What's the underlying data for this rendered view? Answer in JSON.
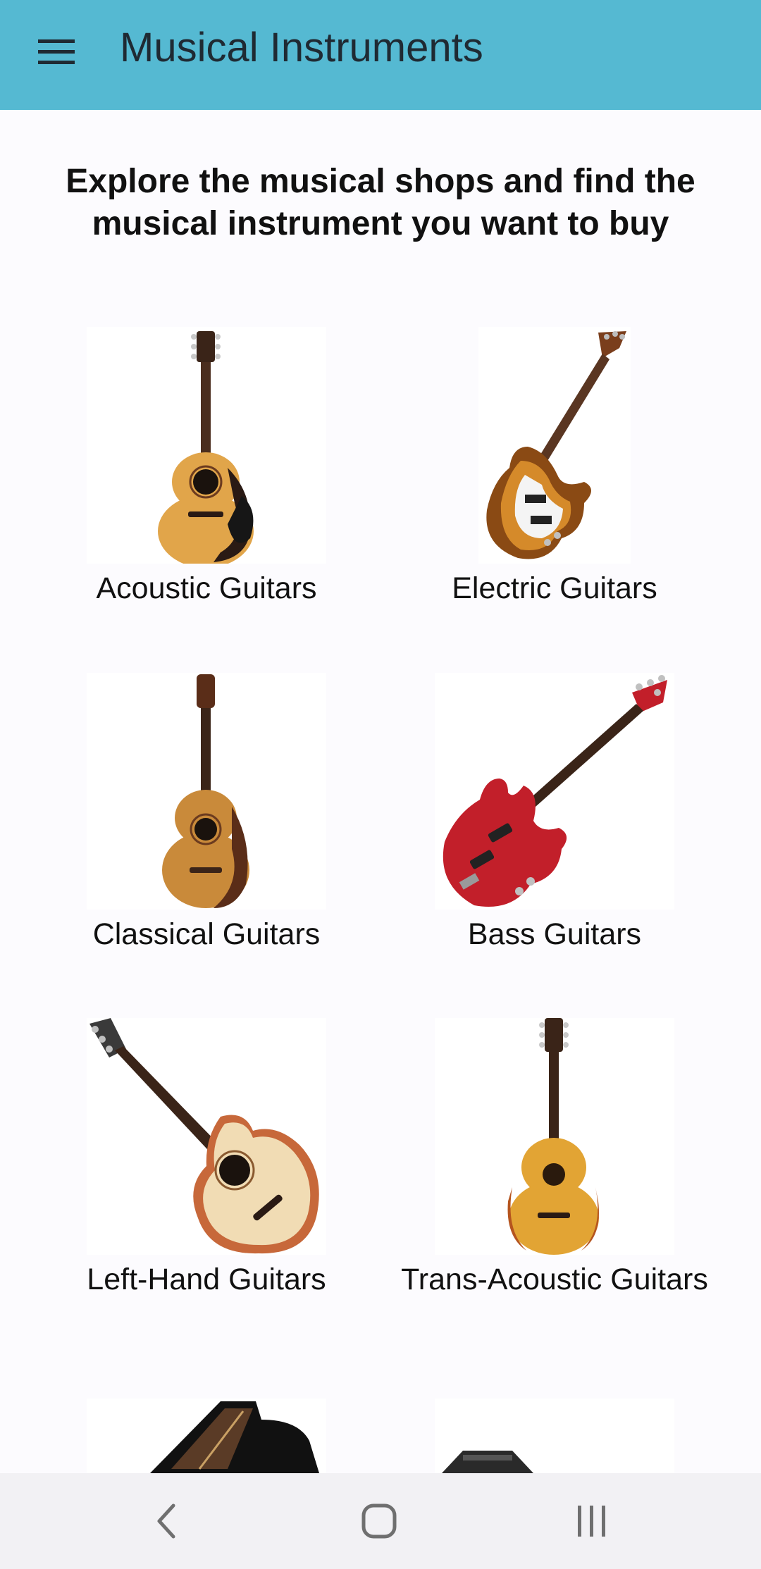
{
  "appbar": {
    "title": "Musical Instruments",
    "menu_icon": "hamburger-menu-icon",
    "background": "#55b9d2"
  },
  "main": {
    "heading": "Explore the musical shops and find the musical instrument you want to buy",
    "categories": [
      {
        "label": "Acoustic Guitars"
      },
      {
        "label": "Electric Guitars"
      },
      {
        "label": "Classical Guitars"
      },
      {
        "label": "Bass Guitars"
      },
      {
        "label": "Left-Hand Guitars"
      },
      {
        "label": "Trans-Acoustic Guitars"
      },
      {
        "label": ""
      },
      {
        "label": ""
      }
    ]
  },
  "navbar": {
    "back_icon": "back-icon",
    "home_icon": "home-icon",
    "recents_icon": "recents-icon"
  }
}
